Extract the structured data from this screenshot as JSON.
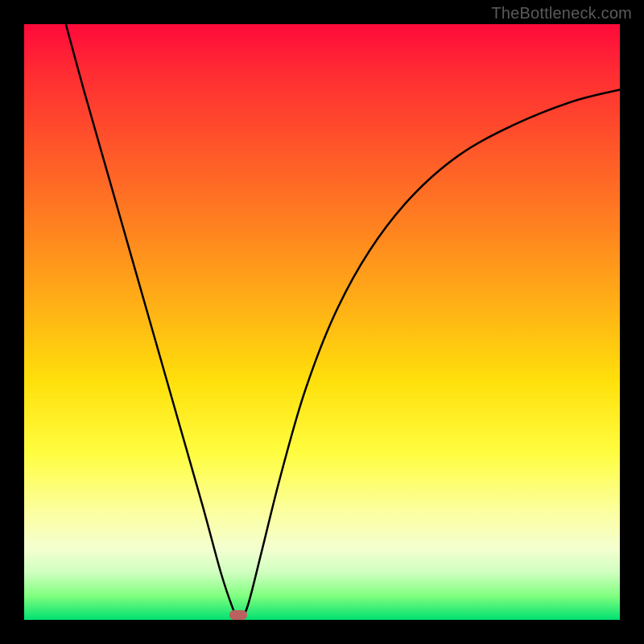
{
  "watermark": "TheBottleneck.com",
  "colors": {
    "frame": "#000000",
    "marker": "#bb5f5f",
    "curve": "#000000"
  },
  "chart_data": {
    "type": "line",
    "title": "",
    "xlabel": "",
    "ylabel": "",
    "xlim": [
      0,
      100
    ],
    "ylim": [
      0,
      100
    ],
    "grid": false,
    "series": [
      {
        "name": "bottleneck-curve",
        "x": [
          7,
          10,
          14,
          18,
          22,
          26,
          30,
          33,
          35,
          36,
          37,
          38,
          40,
          43,
          47,
          52,
          58,
          65,
          73,
          82,
          92,
          100
        ],
        "y": [
          100,
          89,
          75,
          61,
          47,
          33,
          19,
          8,
          2,
          0,
          1,
          4,
          12,
          24,
          38,
          51,
          62,
          71,
          78,
          83,
          87,
          89
        ]
      }
    ],
    "annotations": [
      {
        "name": "min-marker",
        "x": 36,
        "y": 0.8
      }
    ]
  }
}
